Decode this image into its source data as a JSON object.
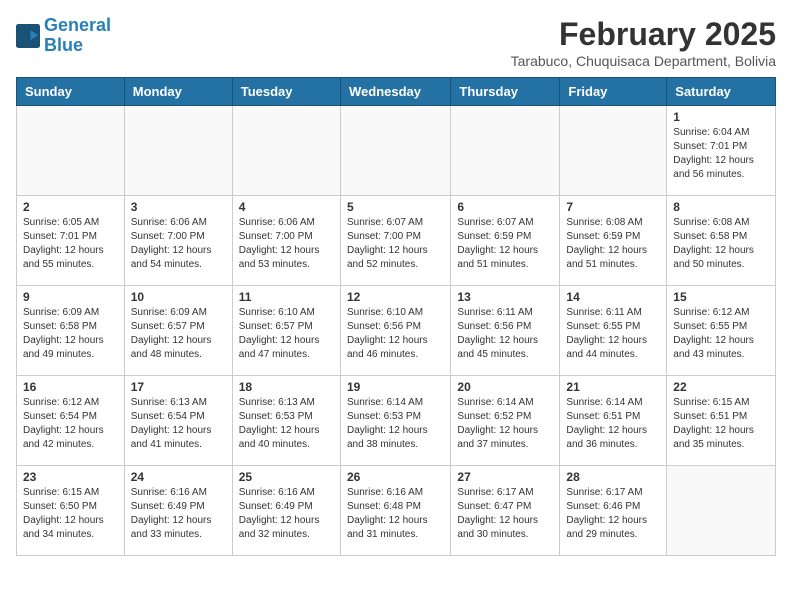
{
  "header": {
    "logo_line1": "General",
    "logo_line2": "Blue",
    "title": "February 2025",
    "subtitle": "Tarabuco, Chuquisaca Department, Bolivia"
  },
  "days_of_week": [
    "Sunday",
    "Monday",
    "Tuesday",
    "Wednesday",
    "Thursday",
    "Friday",
    "Saturday"
  ],
  "weeks": [
    [
      {
        "day": "",
        "info": ""
      },
      {
        "day": "",
        "info": ""
      },
      {
        "day": "",
        "info": ""
      },
      {
        "day": "",
        "info": ""
      },
      {
        "day": "",
        "info": ""
      },
      {
        "day": "",
        "info": ""
      },
      {
        "day": "1",
        "info": "Sunrise: 6:04 AM\nSunset: 7:01 PM\nDaylight: 12 hours and 56 minutes."
      }
    ],
    [
      {
        "day": "2",
        "info": "Sunrise: 6:05 AM\nSunset: 7:01 PM\nDaylight: 12 hours and 55 minutes."
      },
      {
        "day": "3",
        "info": "Sunrise: 6:06 AM\nSunset: 7:00 PM\nDaylight: 12 hours and 54 minutes."
      },
      {
        "day": "4",
        "info": "Sunrise: 6:06 AM\nSunset: 7:00 PM\nDaylight: 12 hours and 53 minutes."
      },
      {
        "day": "5",
        "info": "Sunrise: 6:07 AM\nSunset: 7:00 PM\nDaylight: 12 hours and 52 minutes."
      },
      {
        "day": "6",
        "info": "Sunrise: 6:07 AM\nSunset: 6:59 PM\nDaylight: 12 hours and 51 minutes."
      },
      {
        "day": "7",
        "info": "Sunrise: 6:08 AM\nSunset: 6:59 PM\nDaylight: 12 hours and 51 minutes."
      },
      {
        "day": "8",
        "info": "Sunrise: 6:08 AM\nSunset: 6:58 PM\nDaylight: 12 hours and 50 minutes."
      }
    ],
    [
      {
        "day": "9",
        "info": "Sunrise: 6:09 AM\nSunset: 6:58 PM\nDaylight: 12 hours and 49 minutes."
      },
      {
        "day": "10",
        "info": "Sunrise: 6:09 AM\nSunset: 6:57 PM\nDaylight: 12 hours and 48 minutes."
      },
      {
        "day": "11",
        "info": "Sunrise: 6:10 AM\nSunset: 6:57 PM\nDaylight: 12 hours and 47 minutes."
      },
      {
        "day": "12",
        "info": "Sunrise: 6:10 AM\nSunset: 6:56 PM\nDaylight: 12 hours and 46 minutes."
      },
      {
        "day": "13",
        "info": "Sunrise: 6:11 AM\nSunset: 6:56 PM\nDaylight: 12 hours and 45 minutes."
      },
      {
        "day": "14",
        "info": "Sunrise: 6:11 AM\nSunset: 6:55 PM\nDaylight: 12 hours and 44 minutes."
      },
      {
        "day": "15",
        "info": "Sunrise: 6:12 AM\nSunset: 6:55 PM\nDaylight: 12 hours and 43 minutes."
      }
    ],
    [
      {
        "day": "16",
        "info": "Sunrise: 6:12 AM\nSunset: 6:54 PM\nDaylight: 12 hours and 42 minutes."
      },
      {
        "day": "17",
        "info": "Sunrise: 6:13 AM\nSunset: 6:54 PM\nDaylight: 12 hours and 41 minutes."
      },
      {
        "day": "18",
        "info": "Sunrise: 6:13 AM\nSunset: 6:53 PM\nDaylight: 12 hours and 40 minutes."
      },
      {
        "day": "19",
        "info": "Sunrise: 6:14 AM\nSunset: 6:53 PM\nDaylight: 12 hours and 38 minutes."
      },
      {
        "day": "20",
        "info": "Sunrise: 6:14 AM\nSunset: 6:52 PM\nDaylight: 12 hours and 37 minutes."
      },
      {
        "day": "21",
        "info": "Sunrise: 6:14 AM\nSunset: 6:51 PM\nDaylight: 12 hours and 36 minutes."
      },
      {
        "day": "22",
        "info": "Sunrise: 6:15 AM\nSunset: 6:51 PM\nDaylight: 12 hours and 35 minutes."
      }
    ],
    [
      {
        "day": "23",
        "info": "Sunrise: 6:15 AM\nSunset: 6:50 PM\nDaylight: 12 hours and 34 minutes."
      },
      {
        "day": "24",
        "info": "Sunrise: 6:16 AM\nSunset: 6:49 PM\nDaylight: 12 hours and 33 minutes."
      },
      {
        "day": "25",
        "info": "Sunrise: 6:16 AM\nSunset: 6:49 PM\nDaylight: 12 hours and 32 minutes."
      },
      {
        "day": "26",
        "info": "Sunrise: 6:16 AM\nSunset: 6:48 PM\nDaylight: 12 hours and 31 minutes."
      },
      {
        "day": "27",
        "info": "Sunrise: 6:17 AM\nSunset: 6:47 PM\nDaylight: 12 hours and 30 minutes."
      },
      {
        "day": "28",
        "info": "Sunrise: 6:17 AM\nSunset: 6:46 PM\nDaylight: 12 hours and 29 minutes."
      },
      {
        "day": "",
        "info": ""
      }
    ]
  ]
}
